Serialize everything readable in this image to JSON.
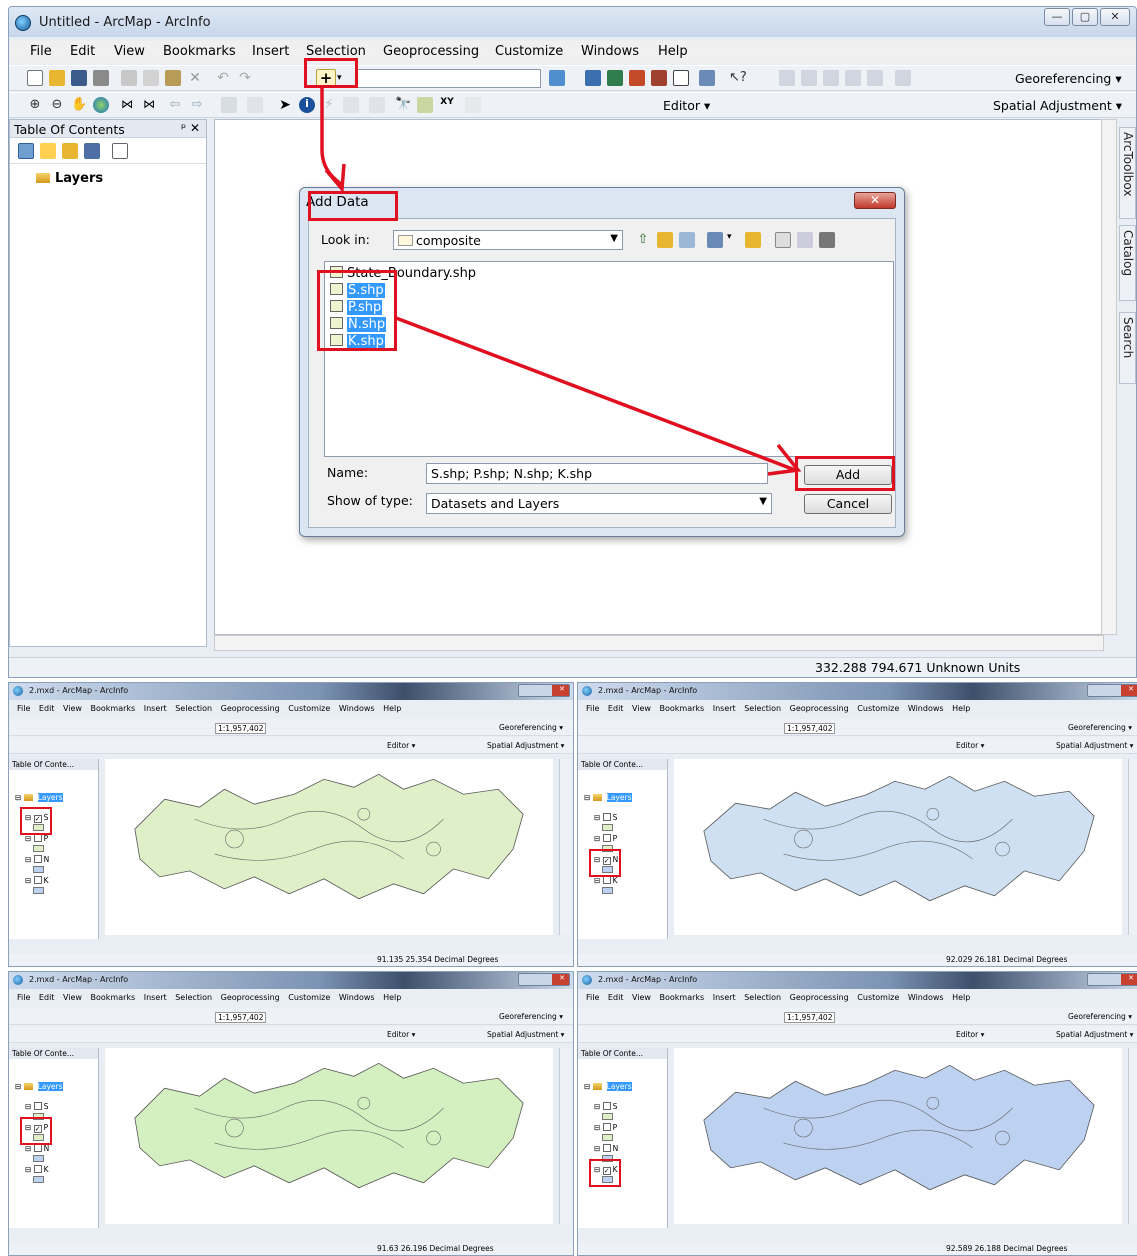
{
  "window": {
    "title": "Untitled - ArcMap - ArcInfo",
    "controls": [
      "—",
      "▢",
      "✕"
    ]
  },
  "menu": [
    "File",
    "Edit",
    "View",
    "Bookmarks",
    "Insert",
    "Selection",
    "Geoprocessing",
    "Customize",
    "Windows",
    "Help"
  ],
  "toolbar": {
    "georeferencing": "Georeferencing ▾",
    "editor": "Editor ▾",
    "spatial_adjustment": "Spatial Adjustment ▾",
    "scale": ""
  },
  "toc": {
    "title": "Table Of Contents",
    "close": "ᵖ ✕",
    "root": "Layers"
  },
  "side_tabs": [
    "ArcToolbox",
    "Catalog",
    "Search"
  ],
  "status": "332.288  794.671 Unknown Units",
  "dialog": {
    "title": "Add Data",
    "close": "✕",
    "look_in_label": "Look in:",
    "look_in_value": "composite",
    "files": [
      "State_Boundary.shp",
      "S.shp",
      "P.shp",
      "N.shp",
      "K.shp"
    ],
    "name_label": "Name:",
    "name_value": "S.shp; P.shp; N.shp; K.shp",
    "type_label": "Show of type:",
    "type_value": "Datasets and Layers",
    "add_button": "Add",
    "cancel_button": "Cancel"
  },
  "subwindows": [
    {
      "title": "2.mxd - ArcMap - ArcInfo",
      "scale": "1:1,957,402",
      "checked": "S",
      "fill": "#dff0c8",
      "status": "91.135  25.354 Decimal Degrees"
    },
    {
      "title": "2.mxd - ArcMap - ArcInfo",
      "scale": "1:1,957,402",
      "checked": "N",
      "fill": "#cfe0f2",
      "status": "92.029  26.181 Decimal Degrees"
    },
    {
      "title": "2.mxd - ArcMap - ArcInfo",
      "scale": "1:1,957,402",
      "checked": "P",
      "fill": "#d4efc0",
      "status": "91.63  26.196 Decimal Degrees"
    },
    {
      "title": "2.mxd - ArcMap - ArcInfo",
      "scale": "1:1,957,402",
      "checked": "K",
      "fill": "#bcd2f0",
      "status": "92.589  26.188 Decimal Degrees"
    }
  ],
  "sub_menu": "File Edit View Bookmarks Insert Selection Geoprocessing Customize Windows Help",
  "sub_toc_title": "Table Of Conte...",
  "layer_names": [
    "S",
    "P",
    "N",
    "K"
  ],
  "colors": {
    "highlight": "#e01020",
    "selection": "#3399ff"
  }
}
